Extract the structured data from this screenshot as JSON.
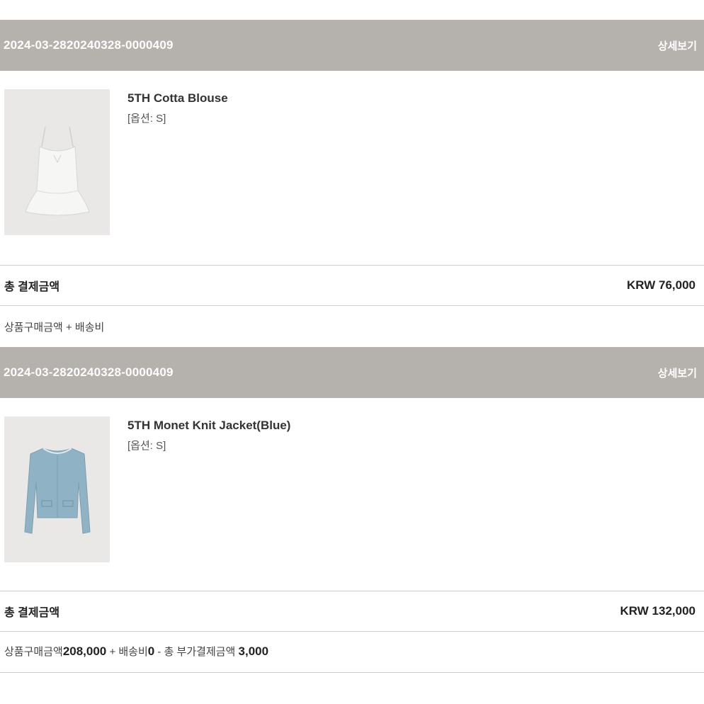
{
  "orders": [
    {
      "order_id": "2024-03-2820240328-0000409",
      "detail_label": "상세보기",
      "product": {
        "name": "5TH Cotta Blouse",
        "option": "[옵션: S]",
        "image_icon": "white-blouse-image",
        "image_color": "#f4f4f2"
      },
      "total_label": "총 결제금액",
      "total_amount": "KRW 76,000",
      "breakdown": {
        "items_label": "상품구매금액",
        "items_value": "",
        "plus": "+",
        "shipping_label": "배송비",
        "shipping_value": ""
      }
    },
    {
      "order_id": "2024-03-2820240328-0000409",
      "detail_label": "상세보기",
      "product": {
        "name": "5TH Monet Knit Jacket(Blue)",
        "option": "[옵션: S]",
        "image_icon": "blue-knit-jacket-image",
        "image_color": "#8fb3c4"
      },
      "total_label": "총 결제금액",
      "total_amount": "KRW 132,000",
      "breakdown": {
        "items_label": "상품구매금액",
        "items_value": "208,000",
        "plus": "+",
        "shipping_label": "배송비",
        "shipping_value": "0",
        "minus": "-",
        "extra_label": "총 부가결제금액",
        "extra_value": "3,000"
      }
    }
  ],
  "colors": {
    "header_bg": "#b5b1ac",
    "divider": "#cfcfcf",
    "thumb_bg": "#e9e8e6"
  }
}
